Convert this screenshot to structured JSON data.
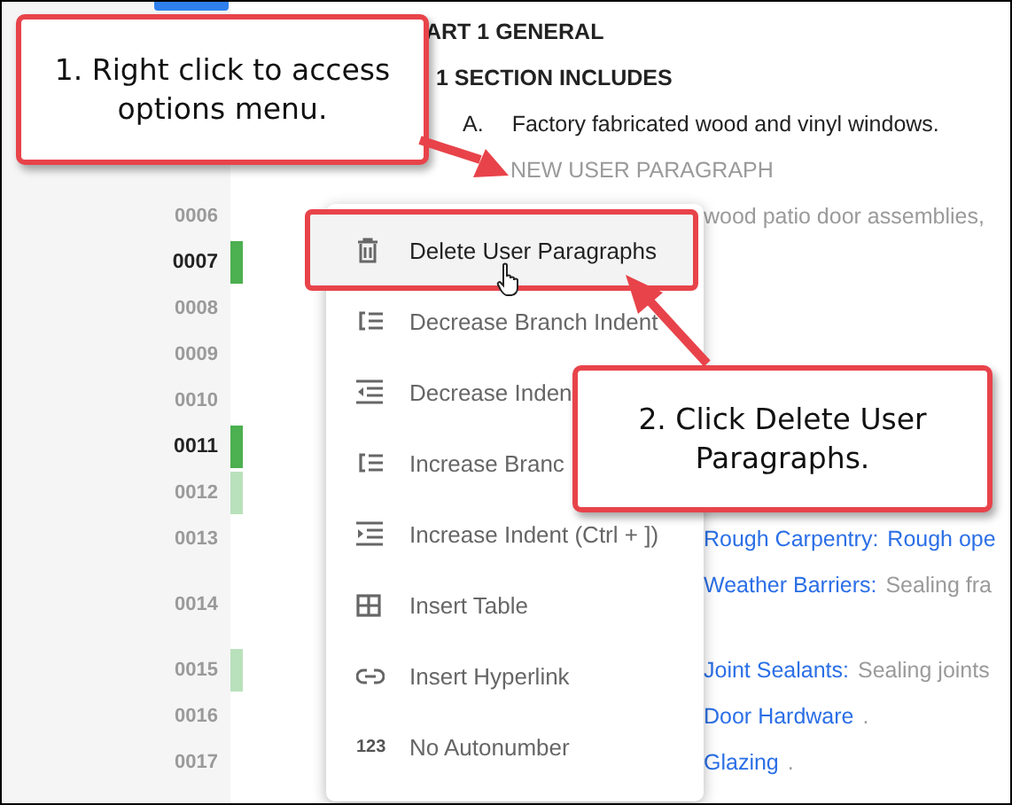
{
  "document": {
    "rows": [
      {
        "kind": "part",
        "segments": [
          {
            "text": "ART 1  GENERAL",
            "kind": "heading"
          }
        ]
      },
      {
        "kind": "article",
        "segments": [
          {
            "text": "1  SECTION INCLUDES",
            "kind": "heading"
          }
        ]
      },
      {
        "kind": "paragraph",
        "segments": [
          {
            "text": "A.",
            "kind": "marker"
          },
          {
            "text": "Factory fabricated wood and vinyl windows.",
            "kind": "body"
          }
        ]
      },
      {
        "kind": "user",
        "segments": [
          {
            "text": "NEW USER PARAGRAPH",
            "kind": "placeholder"
          }
        ]
      },
      {
        "number": "0006",
        "emphasized": false,
        "kind": "continued",
        "segments": [
          {
            "text": "wood patio door assemblies,",
            "kind": "muted"
          }
        ]
      },
      {
        "number": "0007",
        "emphasized": true,
        "color": "#4caf50",
        "kind": "continued",
        "segments": []
      },
      {
        "number": "0008",
        "emphasized": false,
        "kind": "continued",
        "segments": []
      },
      {
        "number": "0009",
        "emphasized": false,
        "kind": "continued",
        "segments": []
      },
      {
        "number": "0010",
        "emphasized": false,
        "kind": "continued",
        "segments": []
      },
      {
        "number": "0011",
        "emphasized": true,
        "color": "#4caf50",
        "kind": "continued",
        "segments": []
      },
      {
        "number": "0012",
        "emphasized": false,
        "color": "#b9e1bb",
        "kind": "continued",
        "segments": []
      },
      {
        "number": "0013",
        "emphasized": false,
        "kind": "continued",
        "segments": [
          {
            "text": "Rough Carpentry:",
            "kind": "link"
          },
          {
            "text": "Rough ope",
            "kind": "link"
          }
        ]
      },
      {
        "number": "0014",
        "emphasized": false,
        "kind": "continued",
        "segments": [
          {
            "text": "Weather Barriers:",
            "kind": "link"
          },
          {
            "text": "Sealing fra",
            "kind": "muted"
          }
        ]
      },
      {
        "number": "0015",
        "emphasized": false,
        "color": "#b9e1bb",
        "kind": "continued",
        "segments": [
          {
            "text": "Joint Sealants:",
            "kind": "link"
          },
          {
            "text": "Sealing joints",
            "kind": "muted"
          }
        ]
      },
      {
        "number": "0016",
        "emphasized": false,
        "kind": "continued",
        "segments": [
          {
            "text": "Door Hardware",
            "kind": "link"
          },
          {
            "text": ".",
            "kind": "muted"
          }
        ]
      },
      {
        "number": "0017",
        "emphasized": false,
        "kind": "continued",
        "segments": [
          {
            "text": "Glazing",
            "kind": "link"
          },
          {
            "text": ".",
            "kind": "muted"
          }
        ]
      }
    ]
  },
  "context_menu": {
    "items": [
      {
        "label": "Delete User Paragraphs",
        "kind": "trash",
        "selected": true
      },
      {
        "label": "Decrease Branch Indent",
        "kind": "decrease-branch",
        "selected": false
      },
      {
        "label": "Decrease Inden",
        "kind": "decrease-indent",
        "selected": false
      },
      {
        "label": "Increase Branc",
        "kind": "increase-branch",
        "selected": false
      },
      {
        "label": "Increase Indent (Ctrl + ])",
        "kind": "increase-indent",
        "selected": false
      },
      {
        "label": "Insert Table",
        "kind": "table",
        "selected": false
      },
      {
        "label": "Insert Hyperlink",
        "kind": "link",
        "selected": false
      },
      {
        "label": "No Autonumber",
        "kind": "glyph",
        "glyph": "123",
        "selected": false
      }
    ]
  },
  "callouts": [
    {
      "text": "1. Right click to access options menu."
    },
    {
      "text": "2. Click Delete User Paragraphs."
    }
  ]
}
